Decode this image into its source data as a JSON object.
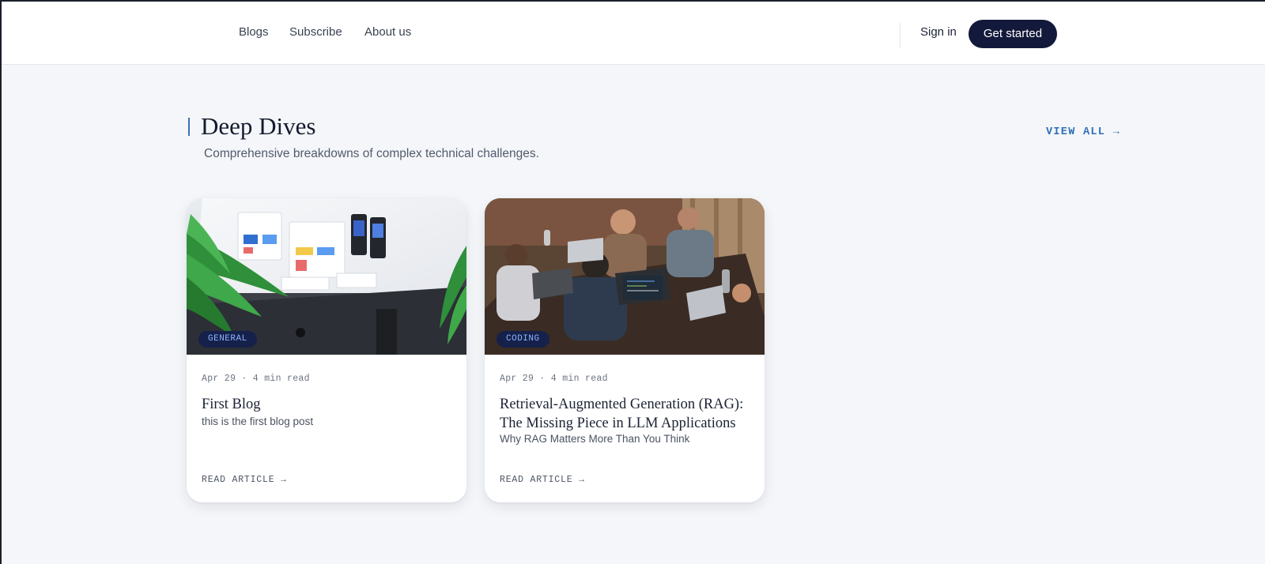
{
  "nav": {
    "links": [
      "Blogs",
      "Subscribe",
      "About us"
    ],
    "sign_in": "Sign in",
    "get_started": "Get started"
  },
  "section": {
    "title": "Deep Dives",
    "subtitle": "Comprehensive breakdowns of complex technical challenges.",
    "view_all": "VIEW ALL →"
  },
  "cards": [
    {
      "tag": "GENERAL",
      "meta": "Apr 29 · 4 min read",
      "title": "First Blog",
      "excerpt": "this is the first blog post",
      "cta": "READ ARTICLE →",
      "image_icon": "desktop-monitor-plant-image"
    },
    {
      "tag": "CODING",
      "meta": "Apr 29 · 4 min read",
      "title": "Retrieval-Augmented Generation (RAG): The Missing Piece in LLM Applications",
      "excerpt": "Why RAG Matters More Than You Think",
      "cta": "READ ARTICLE →",
      "image_icon": "team-laptops-image"
    }
  ],
  "colors": {
    "brand_dark": "#13193a",
    "accent": "#2f6fb6",
    "tag_bg": "#15214a",
    "tag_text": "#8fb4ff",
    "page_bg": "#f4f6f9"
  }
}
